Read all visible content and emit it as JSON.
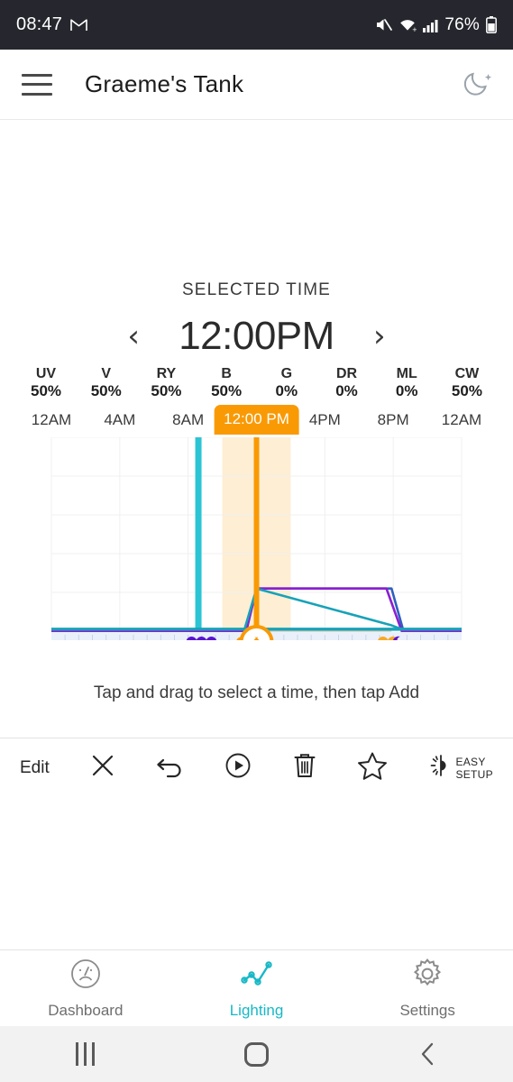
{
  "status_bar": {
    "time": "08:47",
    "mail_icon": "gmail-icon",
    "mute_icon": "mute-icon",
    "wifi_icon": "wifi-icon",
    "signal_icon": "cellular-signal-icon",
    "battery_percent": "76%",
    "battery_icon": "battery-icon"
  },
  "app_bar": {
    "menu_icon": "hamburger-menu-icon",
    "title": "Graeme's  Tank",
    "night_icon": "moon-icon"
  },
  "selected_time": {
    "label": "SELECTED TIME",
    "prev": "‹",
    "value": "12:00PM",
    "next": "›"
  },
  "channels": [
    {
      "name": "UV",
      "value": "50%"
    },
    {
      "name": "V",
      "value": "50%"
    },
    {
      "name": "RY",
      "value": "50%"
    },
    {
      "name": "B",
      "value": "50%"
    },
    {
      "name": "G",
      "value": "0%"
    },
    {
      "name": "DR",
      "value": "0%"
    },
    {
      "name": "ML",
      "value": "0%"
    },
    {
      "name": "CW",
      "value": "50%"
    }
  ],
  "hint": "Tap and drag to select a time, then tap Add",
  "toolbar": {
    "edit_label": "Edit",
    "close_icon": "close-x-icon",
    "undo_icon": "undo-arrow-icon",
    "preview_icon": "play-circle-icon",
    "delete_icon": "trash-icon",
    "favorite_icon": "star-outline-icon",
    "easy_setup_icon": "brightness-half-icon",
    "easy_setup_line1": "EASY",
    "easy_setup_line2": "SETUP"
  },
  "bottom_nav": {
    "items": [
      {
        "label": "Dashboard",
        "icon": "gauge-icon",
        "active": false
      },
      {
        "label": "Lighting",
        "icon": "line-chart-icon",
        "active": true
      },
      {
        "label": "Settings",
        "icon": "gear-icon",
        "active": false
      }
    ]
  },
  "android_nav": {
    "recents_icon": "recents-icon",
    "home_icon": "home-icon",
    "back_icon": "back-chevron-icon"
  },
  "colors": {
    "accent_orange": "#f99a05",
    "selection_band": "#fdeed4",
    "teal": "#17b8c6",
    "cyan_marker": "#2bc4d4",
    "blue_line": "#2f5fc0",
    "purple_line": "#8a1fd0",
    "teal_line": "#17a2b8",
    "status_bar_bg": "#26272e",
    "timeline_strip": "#eaf0fa"
  },
  "chart_data": {
    "type": "line",
    "title": "",
    "xlabel": "",
    "ylabel": "",
    "grid": true,
    "legend": "none",
    "xlim": [
      0,
      24
    ],
    "ylim": [
      0,
      100
    ],
    "xticks": [
      0,
      4,
      8,
      12,
      16,
      20,
      24
    ],
    "xtick_labels": [
      "12AM",
      "4AM",
      "8AM",
      "12:00 PM",
      "4PM",
      "8PM",
      "12AM"
    ],
    "selected_x": 12,
    "selection_band": [
      10.0,
      14.0
    ],
    "marker_line_x": 8.6,
    "series": [
      {
        "name": "blue",
        "color": "#2f5fc0",
        "points": [
          [
            0,
            0
          ],
          [
            11.4,
            0
          ],
          [
            12.0,
            22
          ],
          [
            19.9,
            22
          ],
          [
            20.6,
            0
          ],
          [
            24,
            0
          ]
        ]
      },
      {
        "name": "purple",
        "color": "#8a1fd0",
        "points": [
          [
            0,
            0
          ],
          [
            11.4,
            0
          ],
          [
            12.0,
            22
          ],
          [
            19.6,
            22
          ],
          [
            20.5,
            0
          ],
          [
            24,
            0
          ]
        ]
      },
      {
        "name": "teal",
        "color": "#17a2b8",
        "points": [
          [
            0,
            1
          ],
          [
            11.3,
            1
          ],
          [
            12.0,
            22
          ],
          [
            19.9,
            3
          ],
          [
            20.5,
            1
          ],
          [
            24,
            1
          ]
        ]
      },
      {
        "name": "tan",
        "color": "#d8cbb6",
        "points": [
          [
            12.0,
            0.6
          ],
          [
            19.9,
            0.6
          ]
        ]
      }
    ],
    "timeline_markers": [
      {
        "x": 8.2,
        "type": "dots",
        "color": "#5a14d0",
        "count": 3
      },
      {
        "x": 12.0,
        "type": "handle",
        "color": "#f99a05"
      },
      {
        "x": 19.4,
        "type": "dots",
        "color": "#f9a825",
        "count": 2
      },
      {
        "x": 20.2,
        "type": "moon",
        "color": "#5a14d0"
      }
    ]
  }
}
